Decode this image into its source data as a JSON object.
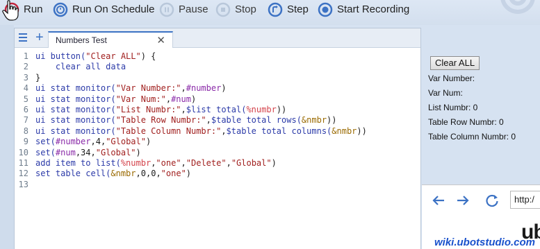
{
  "toolbar": {
    "run": "Run",
    "run_on_schedule": "Run On Schedule",
    "pause": "Pause",
    "stop": "Stop",
    "step": "Step",
    "start_recording": "Start Recording"
  },
  "tabs": [
    {
      "label": "Numbers Test"
    }
  ],
  "editor": {
    "line_numbers": [
      "1",
      "2",
      "3",
      "4",
      "5",
      "6",
      "7",
      "8",
      "9",
      "10",
      "11",
      "12",
      "13"
    ]
  },
  "ui_panel": {
    "clear_button": "Clear ALL",
    "stats": [
      {
        "label": "Var Number:",
        "value": ""
      },
      {
        "label": "Var Num:",
        "value": ""
      },
      {
        "label": "List Numbr: 0",
        "value": ""
      },
      {
        "label": "Table Row Numbr: 0",
        "value": ""
      },
      {
        "label": "Table Column Numbr: 0",
        "value": ""
      }
    ]
  },
  "browser": {
    "address": "http:/"
  },
  "overlay": {
    "watermark": "wiki.ubotstudio.com",
    "logo_peek": "ub"
  },
  "colors": {
    "accent": "#3c72c4",
    "background": "#d6e2f1",
    "run_icon": "#c2253c",
    "keyword": "#2b3aa8",
    "string": "#a1201f",
    "variable": "#8a2aa8",
    "list": "#d4434b",
    "table": "#9a6a00",
    "watermark": "#1a52cc"
  },
  "code_tokens": {
    "l1": [
      "ui button(",
      "\"Clear ALL\"",
      ") {"
    ],
    "l2": [
      "    clear all data"
    ],
    "l3": [
      "}"
    ],
    "l4": [
      "ui stat monitor(",
      "\"Var Number:\"",
      ",",
      "#number",
      ")"
    ],
    "l5": [
      "ui stat monitor(",
      "\"Var Num:\"",
      ",",
      "#num",
      ")"
    ],
    "l6": [
      "ui stat monitor(",
      "\"List Numbr:\"",
      ",",
      "$list total(",
      "%numbr",
      "))"
    ],
    "l7": [
      "ui stat monitor(",
      "\"Table Row Numbr:\"",
      ",",
      "$table total rows(",
      "&nmbr",
      "))"
    ],
    "l8": [
      "ui stat monitor(",
      "\"Table Column Numbr:\"",
      ",",
      "$table total columns(",
      "&nmbr",
      "))"
    ],
    "l9": [
      "set(",
      "#number",
      ",",
      "4",
      ",",
      "\"Global\"",
      ")"
    ],
    "l10": [
      "set(",
      "#num",
      ",",
      "34",
      ",",
      "\"Global\"",
      ")"
    ],
    "l11": [
      "add item to list(",
      "%numbr",
      ",",
      "\"one\"",
      ",",
      "\"Delete\"",
      ",",
      "\"Global\"",
      ")"
    ],
    "l12": [
      "set table cell(",
      "&nmbr",
      ",",
      "0",
      ",",
      "0",
      ",",
      "\"one\"",
      ")"
    ]
  }
}
